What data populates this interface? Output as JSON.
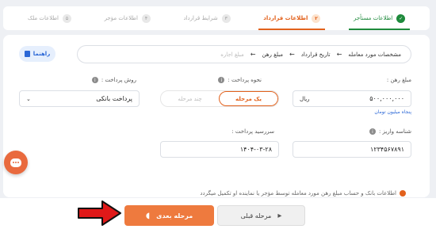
{
  "stepper": {
    "steps": [
      {
        "num": "✓",
        "label": "اطلاعات مستأجر",
        "state": "done"
      },
      {
        "num": "۲",
        "label": "اطلاعات قرارداد",
        "state": "active"
      },
      {
        "num": "۳",
        "label": "شرایط قرارداد",
        "state": "todo"
      },
      {
        "num": "۴",
        "label": "اطلاعات مؤجر",
        "state": "todo"
      },
      {
        "num": "۵",
        "label": "اطلاعات ملک",
        "state": "todo"
      }
    ]
  },
  "breadcrumb": {
    "items": [
      "مشخصات مورد معامله",
      "تاریخ قرارداد",
      "مبلغ رهن",
      "مبلغ اجاره"
    ]
  },
  "guide_button": {
    "label": "راهنما"
  },
  "deposit": {
    "label": "مبلغ رهن :",
    "value": "۵۰۰,۰۰۰,۰۰۰",
    "unit": "ریال",
    "helper": "پنجاه میلیون تومان"
  },
  "payment_method": {
    "label": "نحوه پرداخت :",
    "options": [
      "یک مرحله",
      "چند مرحله"
    ]
  },
  "payment_type": {
    "label": "روش پرداخت :",
    "selected": "پرداخت بانکی"
  },
  "deposit_id": {
    "label": "شناسه واریز :",
    "value": "۱۲۳۴۵۶۷۸۹۱"
  },
  "due_date": {
    "label": "سررسید پرداخت :",
    "value": "۱۴۰۴-۰۳-۲۸"
  },
  "notice": {
    "text": "اطلاعات بانک و حساب مبلغ رهن مورد معامله توسط مؤجر یا نماینده او تکمیل میگردد"
  },
  "footer": {
    "next_label": "مرحله بعدی",
    "prev_label": "مرحله قبلی"
  },
  "colors": {
    "accent": "#e2611c",
    "success": "#1e8a3c",
    "link": "#2b67d6",
    "annotation_arrow": "#e01919"
  }
}
